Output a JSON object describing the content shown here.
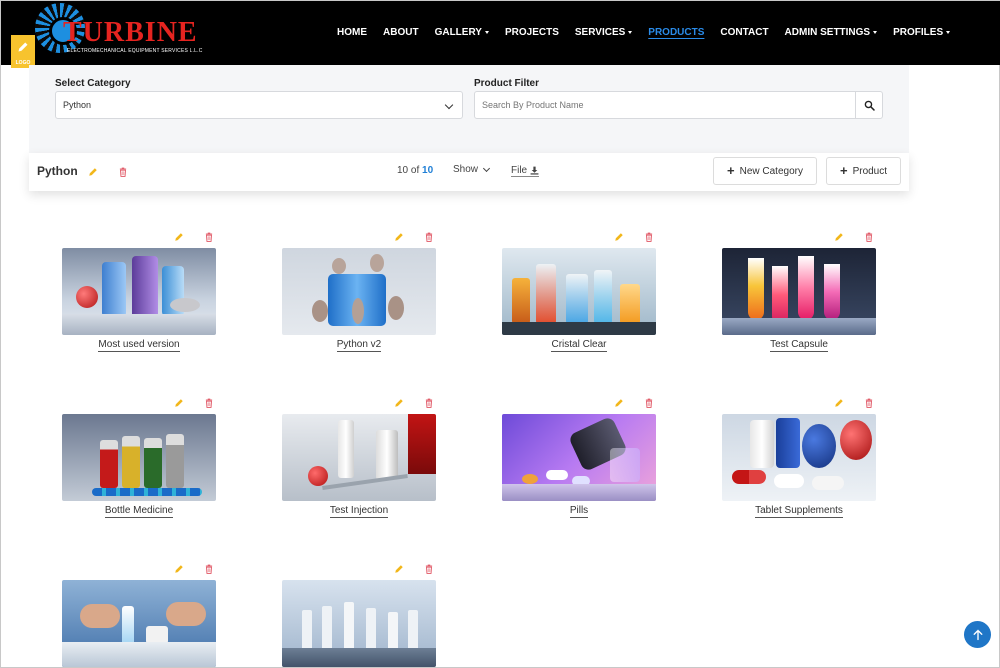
{
  "header": {
    "logo": {
      "name": "TURBINE",
      "tagline": "ELECTROMECHANICAL EQUIPMENT SERVICES L.L.C",
      "badge": "LOGO"
    },
    "nav": [
      {
        "label": "HOME",
        "dropdown": false,
        "active": false
      },
      {
        "label": "ABOUT",
        "dropdown": false,
        "active": false
      },
      {
        "label": "GALLERY",
        "dropdown": true,
        "active": false
      },
      {
        "label": "PROJECTS",
        "dropdown": false,
        "active": false
      },
      {
        "label": "SERVICES",
        "dropdown": true,
        "active": false
      },
      {
        "label": "PRODUCTS",
        "dropdown": false,
        "active": true
      },
      {
        "label": "CONTACT",
        "dropdown": false,
        "active": false
      },
      {
        "label": "ADMIN SETTINGS",
        "dropdown": true,
        "active": false
      },
      {
        "label": "PROFILES",
        "dropdown": true,
        "active": false
      }
    ],
    "accent": "#2a8be8"
  },
  "filters": {
    "category_label": "Select Category",
    "category_value": "Python",
    "product_label": "Product Filter",
    "product_placeholder": "Search By Product Name"
  },
  "toolbar": {
    "title": "Python",
    "count_shown": "10",
    "count_of": "of",
    "count_total": "10",
    "show_label": "Show",
    "file_label": "File",
    "new_category_label": "New Category",
    "product_label": "Product"
  },
  "products": [
    {
      "name": "Most used version",
      "scene": "vials-mice"
    },
    {
      "name": "Python v2",
      "scene": "mice-bottles"
    },
    {
      "name": "Cristal Clear",
      "scene": "lab-glass"
    },
    {
      "name": "Test Capsule",
      "scene": "test-tubes"
    },
    {
      "name": "Bottle Medicine",
      "scene": "bottles"
    },
    {
      "name": "Test Injection",
      "scene": "injection"
    },
    {
      "name": "Pills",
      "scene": "pills-purple"
    },
    {
      "name": "Tablet Supplements",
      "scene": "tablets"
    },
    {
      "name": "",
      "scene": "hands-lab"
    },
    {
      "name": "",
      "scene": "production-line"
    }
  ],
  "colors": {
    "edit": "#f2b71b",
    "delete": "#e05563",
    "count_highlight": "#1f7fd6",
    "scroll_top": "#1f76c7"
  }
}
